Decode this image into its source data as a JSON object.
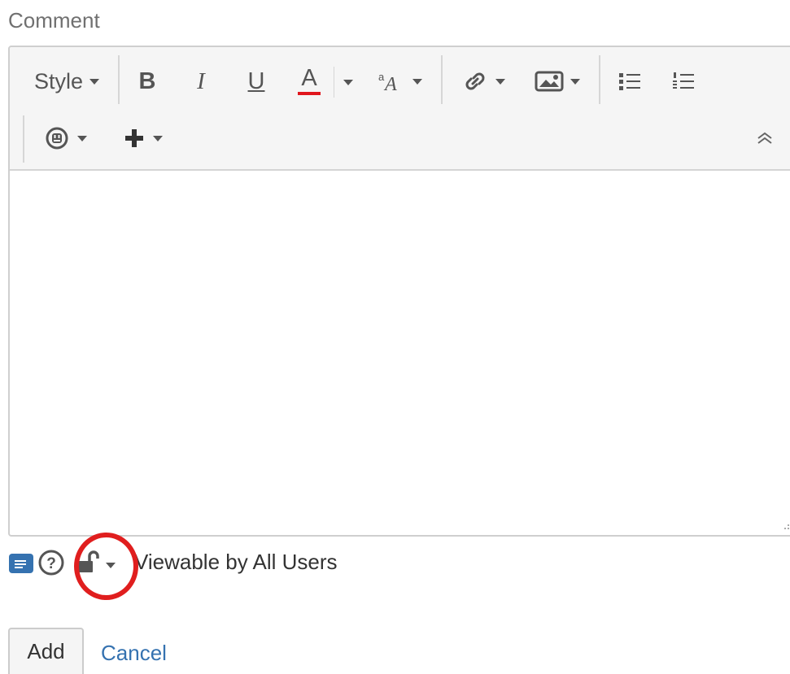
{
  "form": {
    "label": "Comment"
  },
  "toolbar": {
    "style_label": "Style",
    "bold_label": "B",
    "italic_label": "I",
    "underline_label": "U",
    "text_color_label": "A",
    "text_color_underline": "#e0161d"
  },
  "icons": {
    "style_dropdown": "chevron-down-icon",
    "text_color_dropdown": "chevron-down-icon",
    "font_size": "font-size-icon",
    "link": "link-icon",
    "image": "image-icon",
    "bullet_list": "bullet-list-icon",
    "numbered_list": "numbered-list-icon",
    "emoticon": "emoticon-icon",
    "insert_more": "plus-icon",
    "collapse_toolbar": "double-chevron-up-icon",
    "wiki_markup": "wiki-markup-icon",
    "help": "help-icon",
    "security": "unlocked-padlock-icon"
  },
  "footer": {
    "visibility_text": "Viewable by All Users"
  },
  "actions": {
    "add_label": "Add",
    "cancel_label": "Cancel"
  },
  "colors": {
    "link": "#3572b0",
    "highlight": "#e01e1e",
    "wiki_icon": "#3572b0"
  }
}
